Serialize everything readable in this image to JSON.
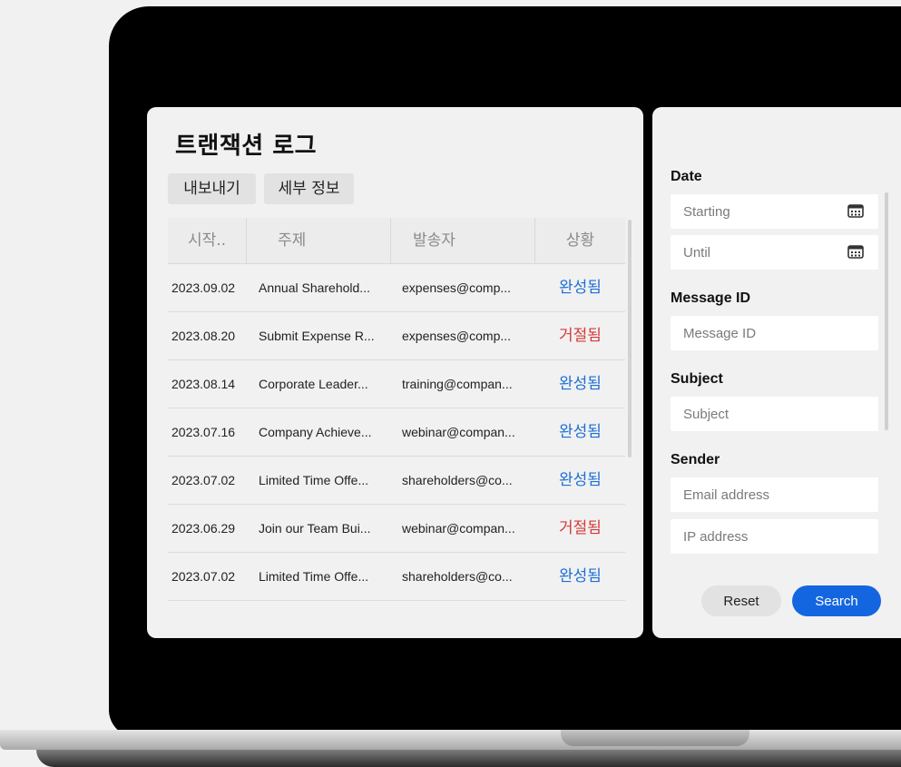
{
  "log_panel": {
    "title": "트랜잭션 로그",
    "export_label": "내보내기",
    "details_label": "세부 정보",
    "columns": [
      "시작..",
      "주제",
      "발송자",
      "상황"
    ],
    "rows": [
      {
        "date": "2023.09.02",
        "subject": "Annual Sharehold...",
        "sender": "expenses@comp...",
        "status": "완성됨",
        "status_type": "completed"
      },
      {
        "date": "2023.08.20",
        "subject": "Submit Expense R...",
        "sender": "expenses@comp...",
        "status": "거절됨",
        "status_type": "rejected"
      },
      {
        "date": "2023.08.14",
        "subject": "Corporate Leader...",
        "sender": "training@compan...",
        "status": "완성됨",
        "status_type": "completed"
      },
      {
        "date": "2023.07.16",
        "subject": "Company Achieve...",
        "sender": "webinar@compan...",
        "status": "완성됨",
        "status_type": "completed"
      },
      {
        "date": "2023.07.02",
        "subject": "Limited Time Offe...",
        "sender": "shareholders@co...",
        "status": "완성됨",
        "status_type": "completed"
      },
      {
        "date": "2023.06.29",
        "subject": "Join our Team Bui...",
        "sender": "webinar@compan...",
        "status": "거절됨",
        "status_type": "rejected"
      },
      {
        "date": "2023.07.02",
        "subject": "Limited Time Offe...",
        "sender": "shareholders@co...",
        "status": "완성됨",
        "status_type": "completed"
      }
    ]
  },
  "filter_panel": {
    "date_label": "Date",
    "starting_placeholder": "Starting",
    "until_placeholder": "Until",
    "message_id_label": "Message ID",
    "message_id_placeholder": "Message ID",
    "subject_label": "Subject",
    "subject_placeholder": "Subject",
    "sender_label": "Sender",
    "email_placeholder": "Email address",
    "ip_placeholder": "IP address",
    "reset_label": "Reset",
    "search_label": "Search"
  },
  "icons": {
    "calendar": "calendar-icon"
  },
  "colors": {
    "completed": "#1d6fd6",
    "rejected": "#d63a3a",
    "primary": "#1466e0"
  }
}
